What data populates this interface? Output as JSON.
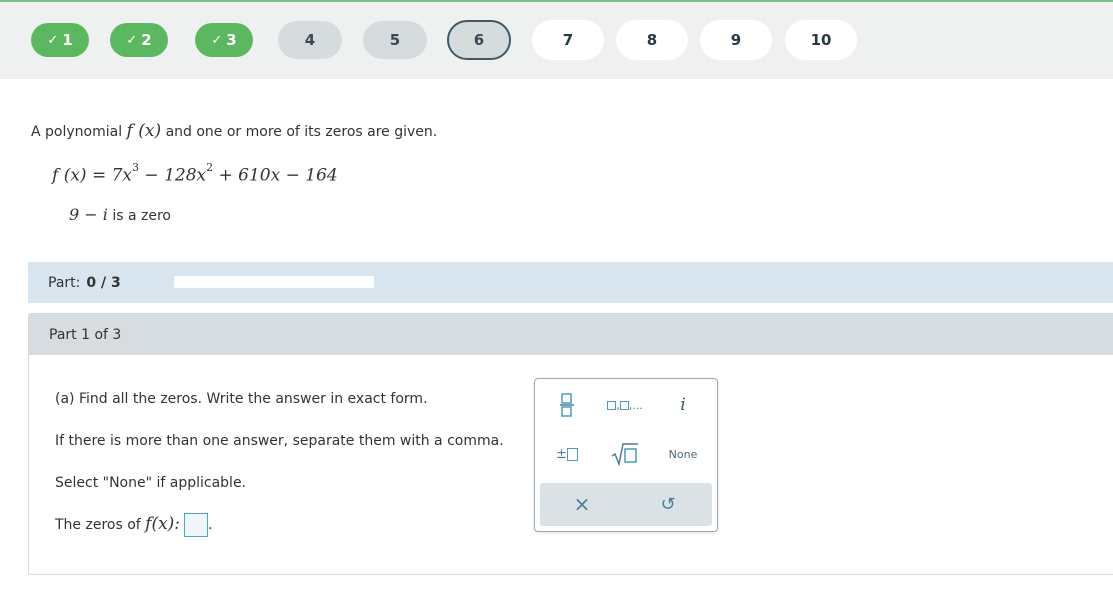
{
  "nav": {
    "questions": [
      {
        "label": "1",
        "state": "done"
      },
      {
        "label": "2",
        "state": "done"
      },
      {
        "label": "3",
        "state": "done"
      },
      {
        "label": "4",
        "state": "visited"
      },
      {
        "label": "5",
        "state": "visited"
      },
      {
        "label": "6",
        "state": "current"
      },
      {
        "label": "7",
        "state": "todo"
      },
      {
        "label": "8",
        "state": "todo"
      },
      {
        "label": "9",
        "state": "todo"
      },
      {
        "label": "10",
        "state": "todo"
      }
    ],
    "check_icon": "check-icon"
  },
  "problem": {
    "prompt_pre": "A polynomial",
    "prompt_fx": "f (x)",
    "prompt_post": "and one or more of its zeros are given.",
    "equation": {
      "lhs": "f (x) = 7x",
      "exp1": "3",
      "mid1": " − 128x",
      "exp2": "2",
      "rest": " + 610x − 164"
    },
    "zero_value": "9 − i",
    "zero_text": "is a zero"
  },
  "part_progress": {
    "label": "Part:",
    "value": "0 / 3",
    "fraction": 0.0
  },
  "part": {
    "header": "Part 1 of 3",
    "instruction": "(a) Find all the zeros. Write the answer in exact form.",
    "separator_note": "If there is more than one answer, separate them with a comma.",
    "none_note": "Select \"None\" if applicable.",
    "answer_label": "The zeros of",
    "answer_fx": "f(x):",
    "answer_suffix": "."
  },
  "keypad": {
    "none_label": "None",
    "imag_label": "i",
    "plusminus_label": "±",
    "list_label": ",...",
    "clear_label": "×",
    "undo_label": "↺"
  },
  "colors": {
    "done": "#5cb860",
    "current_border": "#3d5a6a",
    "accent": "#4b9bc0"
  }
}
